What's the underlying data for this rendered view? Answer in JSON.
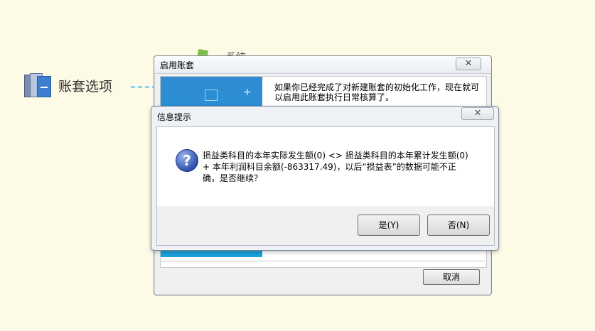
{
  "background": {
    "item_label": "账套选项",
    "item2_label": "系统"
  },
  "dialog_main": {
    "title": "启用账套",
    "close_label": "✕",
    "message": "如果你已经完成了对新建账套的初始化工作，现在就可以启用此账套执行日常核算了。",
    "cancel_label": "取消"
  },
  "dialog_info": {
    "title": "信息提示",
    "close_label": "✕",
    "message_line1": "损益类科目的本年实际发生额(0) <> 损益类科目的本年累计发生额(0)",
    "message_line2": "+ 本年利润科目余额(-863317.49)，以后“损益表”的数据可能不正",
    "message_line3": "确，是否继续？",
    "yes_label": "是(Y)",
    "no_label": "否(N)"
  },
  "icons": [
    "ledger-icon",
    "app-icon",
    "question-icon",
    "close-icon",
    "plus-icon"
  ]
}
